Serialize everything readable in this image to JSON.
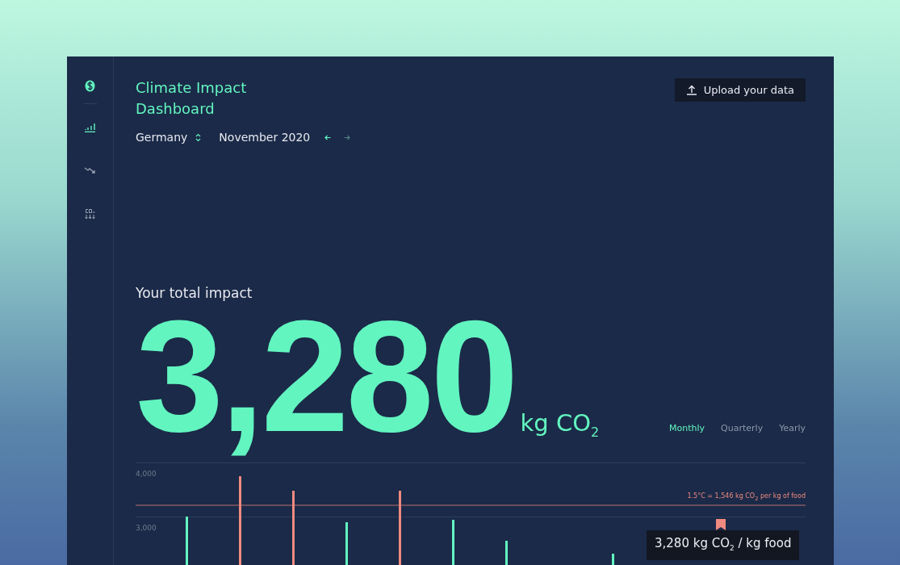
{
  "sidebar": {
    "items": [
      {
        "kind": "bars",
        "selected": true
      },
      {
        "kind": "trend",
        "selected": false
      },
      {
        "kind": "co2",
        "selected": false
      }
    ]
  },
  "header": {
    "title": "Climate Impact Dashboard",
    "upload_button": "Upload your data"
  },
  "filters": {
    "country": "Germany",
    "month": "November 2020",
    "prev_enabled": true,
    "next_enabled": false
  },
  "total": {
    "label": "Your total impact",
    "value": "3,280",
    "unit": "kg CO$_{2}$"
  },
  "periods": [
    {
      "label": "Monthly",
      "selected": true
    },
    {
      "label": "Quarterly",
      "selected": false
    },
    {
      "label": "Yearly",
      "selected": false
    }
  ],
  "chart": {
    "axis_labels": [
      "4,000",
      "3,000"
    ],
    "threshold_label": "1.5°C  = 1,546 kg CO$_{2}$ per kg of food",
    "tooltip": "3,280 kg CO$_{2}$ / kg food"
  }
}
